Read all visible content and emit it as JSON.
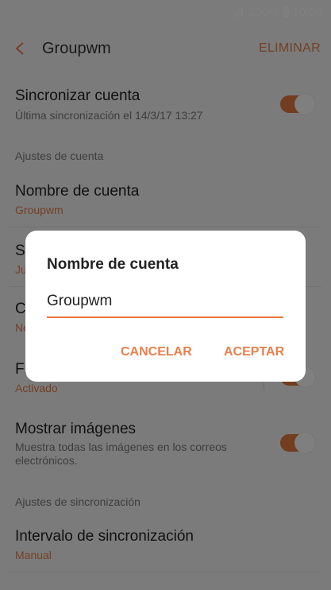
{
  "status_bar": {
    "battery": "100%",
    "time": "10:00"
  },
  "header": {
    "title": "Groupwm",
    "action": "ELIMINAR"
  },
  "settings": {
    "sync_account": {
      "title": "Sincronizar cuenta",
      "subtitle": "Última sincronización el 14/3/17  13:27",
      "enabled": true
    },
    "section_account": "Ajustes de cuenta",
    "account_name": {
      "title": "Nombre de cuenta",
      "value": "Groupwm"
    },
    "row_s": {
      "title": "S",
      "value": "Ju"
    },
    "row_c": {
      "title": "C",
      "value": "No"
    },
    "row_f": {
      "title": "Fi",
      "value": "Activado",
      "enabled": true
    },
    "show_images": {
      "title": "Mostrar imágenes",
      "subtitle": "Muestra todas las imágenes en los correos electrónicos.",
      "enabled": true
    },
    "section_sync": "Ajustes de sincronización",
    "sync_interval": {
      "title": "Intervalo de sincronización",
      "value": "Manual"
    }
  },
  "dialog": {
    "title": "Nombre de cuenta",
    "input_value": "Groupwm",
    "cancel": "CANCELAR",
    "accept": "ACEPTAR"
  },
  "colors": {
    "accent": "#e67a3f",
    "background": "#f7f7f7",
    "scrim": "rgba(0,0,0,0.5)"
  }
}
